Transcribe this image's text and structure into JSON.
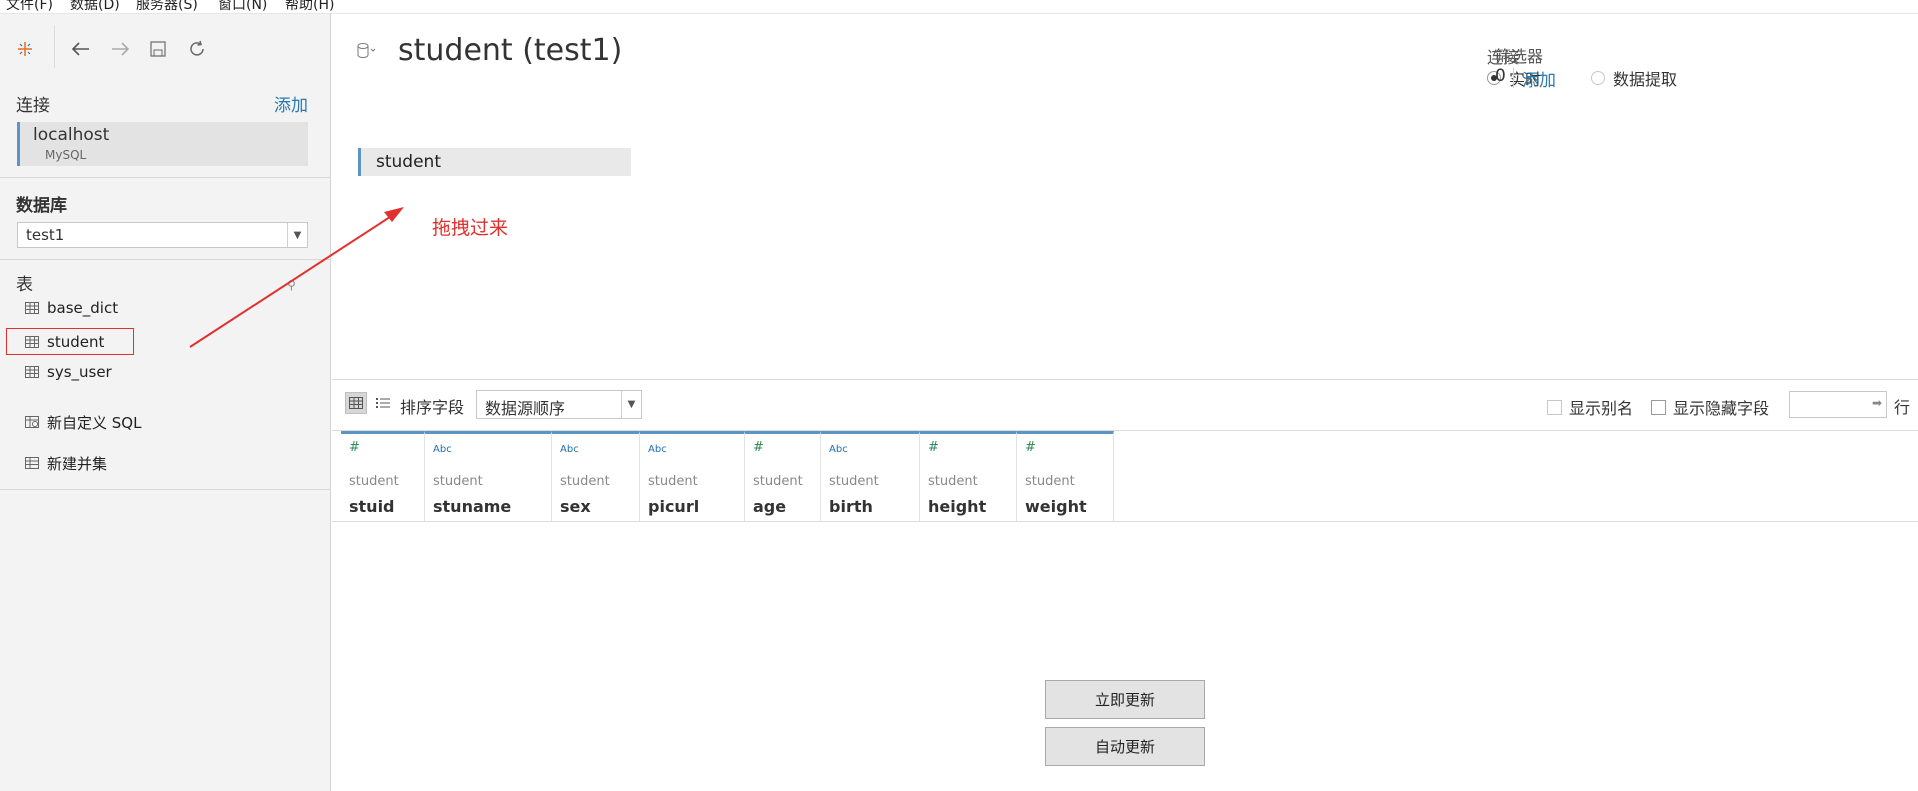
{
  "menubar": [
    {
      "label": "文件(F)"
    },
    {
      "label": "数据(D)"
    },
    {
      "label": "服务器(S)"
    },
    {
      "label": "窗口(N)"
    },
    {
      "label": "帮助(H)"
    }
  ],
  "toolbar": {
    "icons": [
      "tableau-logo-icon",
      "back-icon",
      "forward-icon",
      "save-icon",
      "refresh-icon"
    ]
  },
  "sidebar": {
    "connections_title": "连接",
    "add_label": "添加",
    "connection": {
      "name": "localhost",
      "type": "MySQL"
    },
    "database_title": "数据库",
    "database_value": "test1",
    "tables_title": "表",
    "tables": [
      {
        "label": "base_dict"
      },
      {
        "label": "student"
      },
      {
        "label": "sys_user"
      }
    ],
    "custom_sql": "新自定义 SQL",
    "new_union": "新建并集"
  },
  "main": {
    "title": "student (test1)",
    "connection_label": "连接",
    "live_label": "实时",
    "extract_label": "数据提取",
    "filters_label": "筛选器",
    "filters_count": "0",
    "filters_add": "添加",
    "canvas_table": "student",
    "drag_note": "拖拽过来"
  },
  "grid_toolbar": {
    "sort_label": "排序字段",
    "sort_value": "数据源顺序",
    "show_alias": "显示别名",
    "show_hidden": "显示隐藏字段",
    "rows_label": "行"
  },
  "fields": [
    {
      "type": "#",
      "source": "student",
      "name": "stuid"
    },
    {
      "type": "Abc",
      "source": "student",
      "name": "stuname"
    },
    {
      "type": "Abc",
      "source": "student",
      "name": "sex"
    },
    {
      "type": "Abc",
      "source": "student",
      "name": "picurl"
    },
    {
      "type": "#",
      "source": "student",
      "name": "age"
    },
    {
      "type": "Abc",
      "source": "student",
      "name": "birth"
    },
    {
      "type": "#",
      "source": "student",
      "name": "height"
    },
    {
      "type": "#",
      "source": "student",
      "name": "weight"
    }
  ],
  "buttons": {
    "update_now": "立即更新",
    "auto_update": "自动更新"
  },
  "colors": {
    "accent_blue": "#5b94c5",
    "link_blue": "#2a7ab0",
    "annotation_red": "#e0312f"
  }
}
